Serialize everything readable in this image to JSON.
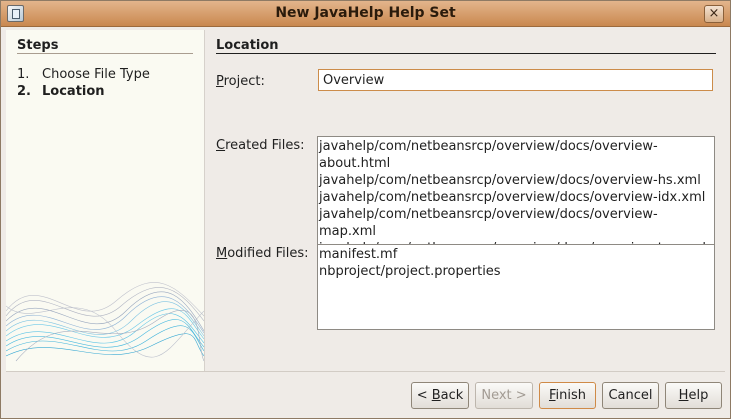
{
  "window": {
    "title": "New JavaHelp Help Set",
    "close_glyph": "×"
  },
  "steps": {
    "heading": "Steps",
    "items": [
      {
        "num": "1.",
        "label": "Choose File Type"
      },
      {
        "num": "2.",
        "label": "Location"
      }
    ]
  },
  "location": {
    "heading": "Location",
    "project_label_mnemonic": "P",
    "project_label_rest": "roject:",
    "project_value": "Overview",
    "created_label_mnemonic": "C",
    "created_label_rest": "reated Files:",
    "created_files": [
      "javahelp/com/netbeansrcp/overview/docs/overview-about.html",
      "javahelp/com/netbeansrcp/overview/docs/overview-hs.xml",
      "javahelp/com/netbeansrcp/overview/docs/overview-idx.xml",
      "javahelp/com/netbeansrcp/overview/docs/overview-map.xml",
      "javahelp/com/netbeansrcp/overview/docs/overview-toc.xml"
    ],
    "modified_label_mnemonic": "M",
    "modified_label_rest": "odified Files:",
    "modified_files": [
      "manifest.mf",
      "nbproject/project.properties"
    ]
  },
  "buttons": {
    "back": {
      "prefix": "< ",
      "mnemonic": "B",
      "rest": "ack"
    },
    "next": "Next >",
    "finish": {
      "mnemonic": "F",
      "rest": "inish"
    },
    "cancel": "Cancel",
    "help": {
      "mnemonic": "H",
      "rest": "elp"
    }
  },
  "colors": {
    "title_bar": "#c9884f",
    "focus_border": "#cc8c4a",
    "panel_bg": "#efebe7"
  }
}
